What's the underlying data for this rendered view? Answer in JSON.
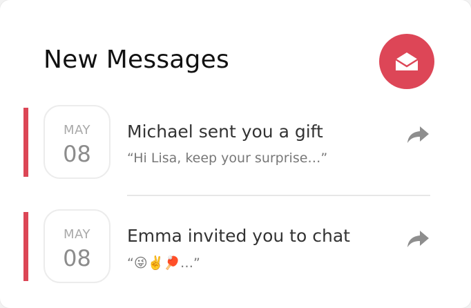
{
  "header": {
    "title": "New Messages",
    "mail_icon": "envelope-icon",
    "accent_color": "#dd4657"
  },
  "messages": [
    {
      "month": "MAY",
      "day": "08",
      "title": "Michael sent you a gift",
      "preview": "“Hi Lisa, keep your surprise…”",
      "action_icon": "share-arrow-icon"
    },
    {
      "month": "MAY",
      "day": "08",
      "title": "Emma invited you to chat",
      "preview": "“😜✌️🏓…”",
      "action_icon": "share-arrow-icon"
    }
  ]
}
